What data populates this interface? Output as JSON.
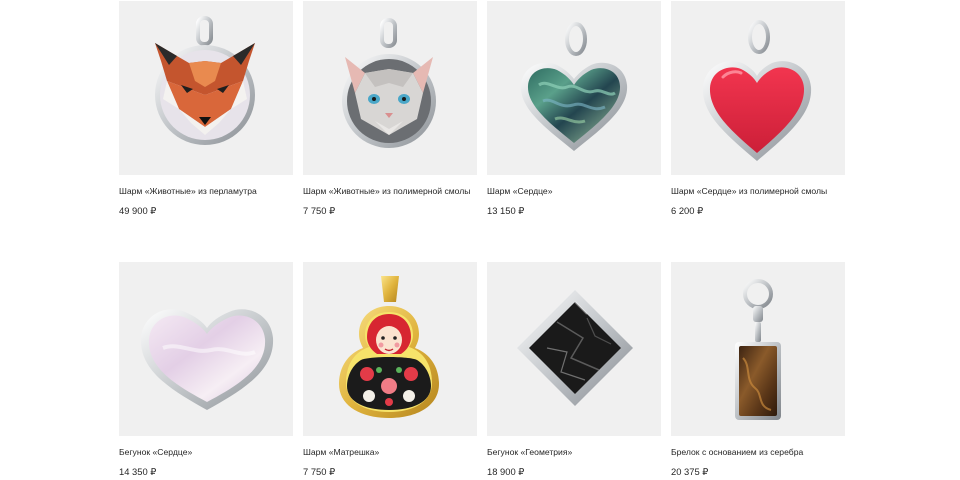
{
  "products": [
    {
      "name": "Шарм «Животные» из перламутра",
      "price": "49 900 ₽",
      "image": "fox-charm-icon"
    },
    {
      "name": "Шарм «Животные» из полимерной смолы",
      "price": "7 750 ₽",
      "image": "cat-charm-icon"
    },
    {
      "name": "Шарм «Сердце»",
      "price": "13 150 ₽",
      "image": "abalone-heart-icon"
    },
    {
      "name": "Шарм «Сердце» из полимерной смолы",
      "price": "6 200 ₽",
      "image": "red-heart-icon"
    },
    {
      "name": "Бегунок «Сердце»",
      "price": "14 350 ₽",
      "image": "pearl-heart-slider-icon"
    },
    {
      "name": "Шарм «Матрешка»",
      "price": "7 750 ₽",
      "image": "matryoshka-charm-icon"
    },
    {
      "name": "Бегунок «Геометрия»",
      "price": "18 900 ₽",
      "image": "marble-square-slider-icon"
    },
    {
      "name": "Брелок с основанием из серебра",
      "price": "20 375 ₽",
      "image": "silver-keychain-icon"
    }
  ],
  "colors": {
    "background": "#ffffff",
    "thumb_background": "#f0f0f0",
    "text": "#262626"
  }
}
